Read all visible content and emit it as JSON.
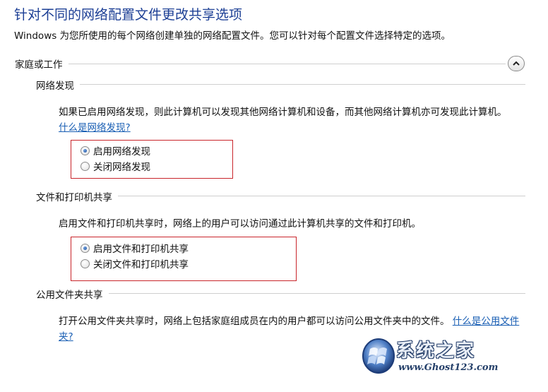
{
  "page_title": "针对不同的网络配置文件更改共享选项",
  "page_desc": "Windows 为您所使用的每个网络创建单独的网络配置文件。您可以针对每个配置文件选择特定的选项。",
  "profile": {
    "label": "家庭或工作",
    "collapse_icon": "chevron-up-icon"
  },
  "network_discovery": {
    "label": "网络发现",
    "text": "如果已启用网络发现，则此计算机可以发现其他网络计算机和设备，而其他网络计算机亦可发现此计算机。",
    "link": "什么是网络发现?",
    "options": [
      "启用网络发现",
      "关闭网络发现"
    ],
    "selected": 0
  },
  "file_printer_sharing": {
    "label": "文件和打印机共享",
    "text": "启用文件和打印机共享时，网络上的用户可以访问通过此计算机共享的文件和打印机。",
    "options": [
      "启用文件和打印机共享",
      "关闭文件和打印机共享"
    ],
    "selected": 0
  },
  "public_folder_sharing": {
    "label": "公用文件夹共享",
    "text": "打开公用文件夹共享时，网络上包括家庭组成员在内的用户都可以访问公用文件夹中的文件。",
    "link": "什么是公用文件夹?"
  },
  "watermark": {
    "name": "系统之家",
    "url": "www.Ghost123.com",
    "logo_icon": "windows-orb-logo",
    "colors": {
      "accent": "#1c3f95",
      "link": "#1a5fb4",
      "highlight_box": "#c9252b"
    }
  }
}
